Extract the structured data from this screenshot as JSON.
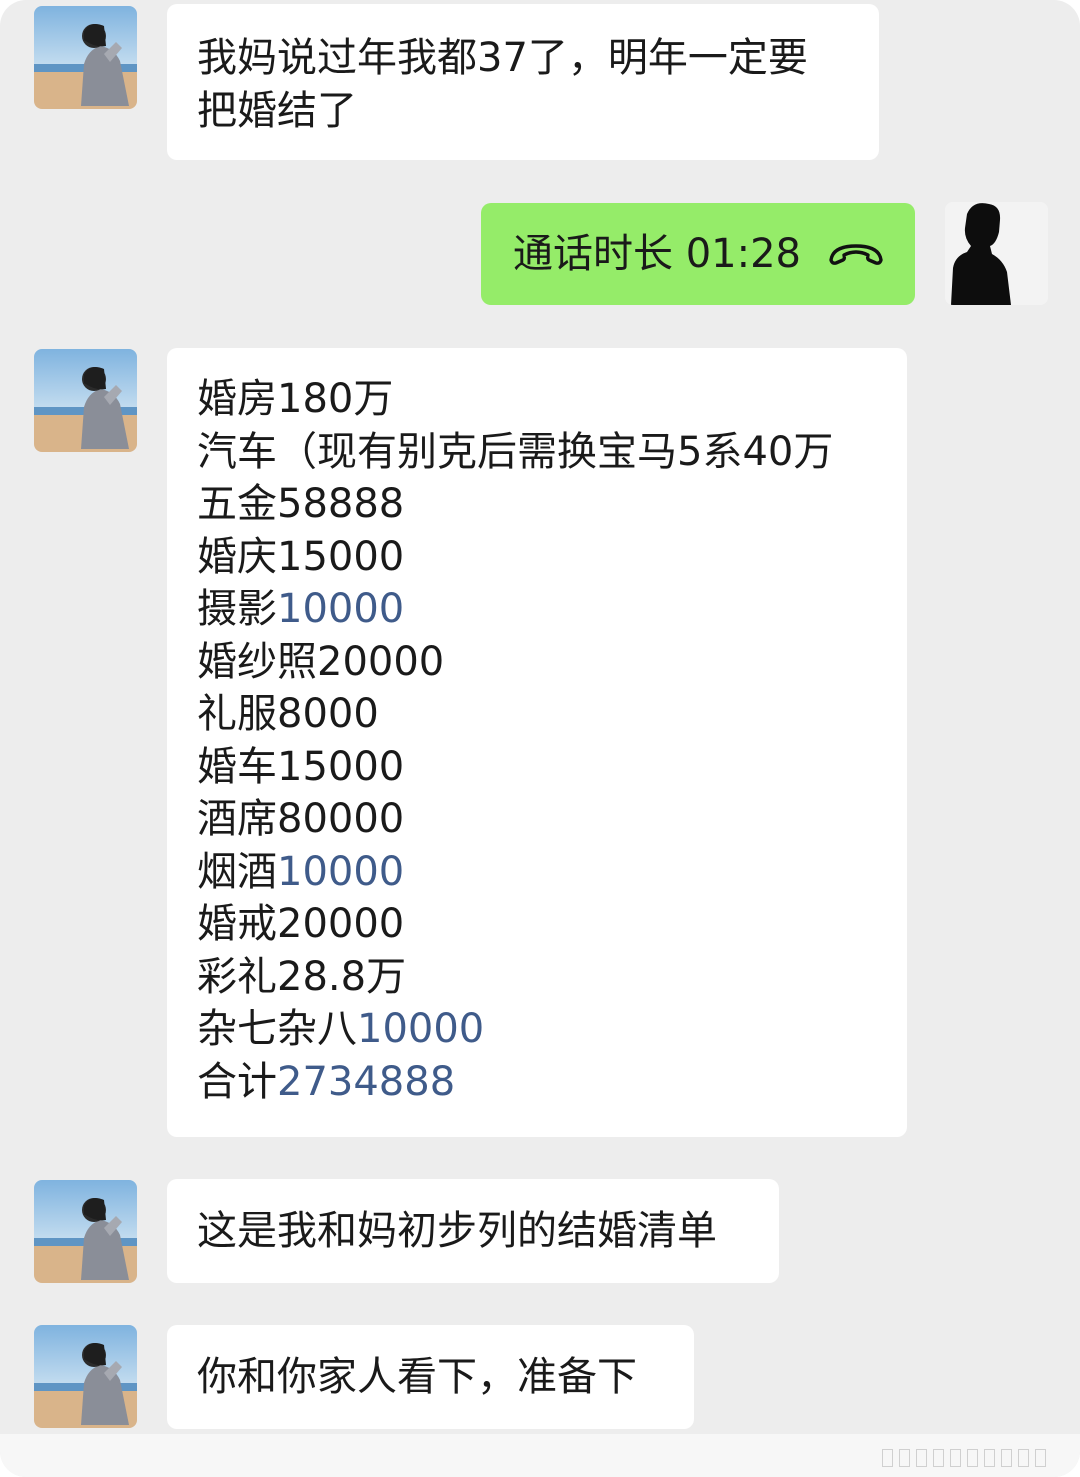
{
  "messages": [
    {
      "text": "我妈说过年我都37了，明年一定要\n把婚结了"
    },
    {
      "call_label": "通话时长 01:28"
    },
    {
      "list": [
        {
          "label": "婚房",
          "value": "180万"
        },
        {
          "label": "汽车（现有别克后需换宝马5系",
          "value": "40万"
        },
        {
          "label": "五金",
          "value": "58888"
        },
        {
          "label": "婚庆",
          "value": "15000"
        },
        {
          "label": "摄影",
          "value": "10000"
        },
        {
          "label": "婚纱照",
          "value": "20000"
        },
        {
          "label": "礼服",
          "value": "8000"
        },
        {
          "label": "婚车",
          "value": "15000"
        },
        {
          "label": "酒席",
          "value": "80000"
        },
        {
          "label": "烟酒",
          "value": "10000"
        },
        {
          "label": "婚戒",
          "value": "20000"
        },
        {
          "label": "彩礼",
          "value": "28.8万"
        },
        {
          "label": "杂七杂八",
          "value": "10000"
        },
        {
          "label": "合计",
          "value": "2734888"
        }
      ]
    },
    {
      "text": "这是我和妈初步列的结婚清单"
    },
    {
      "text": "你和你家人看下，准备下"
    }
  ],
  "colors": {
    "chat_background": "#ededed",
    "incoming_bubble": "#ffffff",
    "outgoing_bubble": "#95ec69",
    "linked_number": "#3f5b8a"
  }
}
